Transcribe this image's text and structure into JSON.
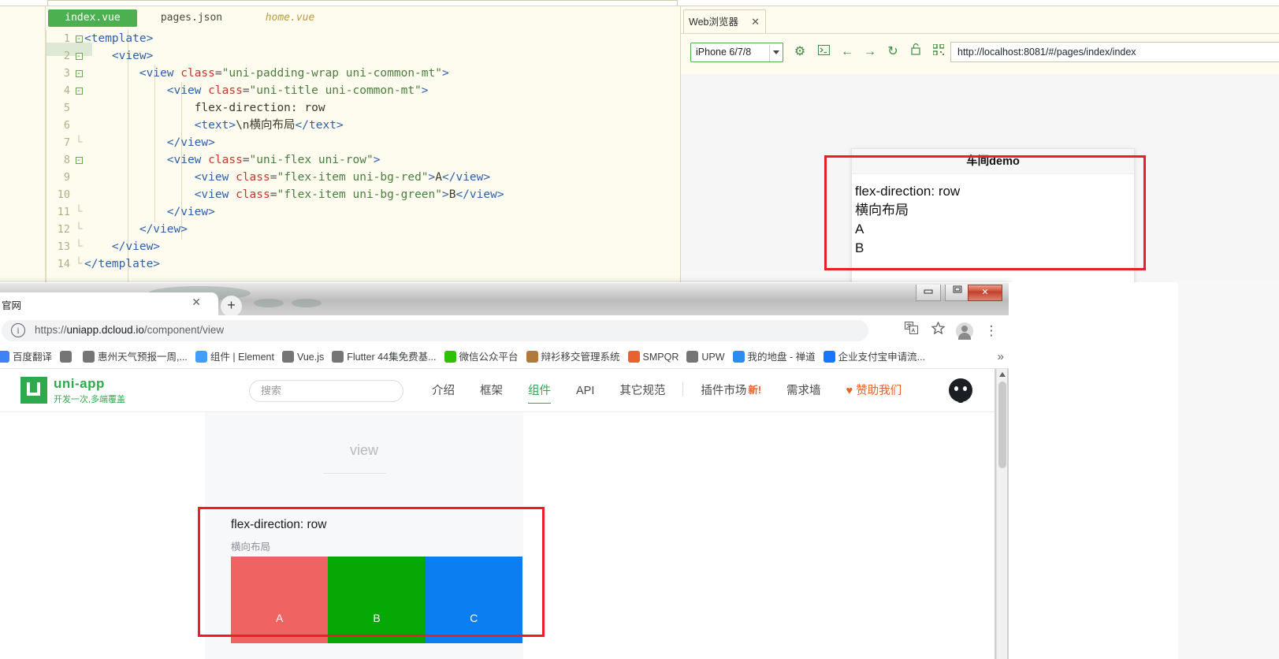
{
  "ide": {
    "tabs": [
      {
        "label": "index.vue",
        "state": "active"
      },
      {
        "label": "pages.json",
        "state": "inactive"
      },
      {
        "label": "home.vue",
        "state": "italic"
      }
    ],
    "code_lines": [
      {
        "num": "1",
        "fold": "minus",
        "html": "<span class=\"tk-tag\">&lt;template&gt;</span>"
      },
      {
        "num": "2",
        "fold": "minus",
        "html": "    <span class=\"tk-tag\">&lt;view&gt;</span>"
      },
      {
        "num": "3",
        "fold": "minus",
        "html": "        <span class=\"tk-tag\">&lt;view </span><span class=\"tk-attr\">class</span><span class=\"tk-eq\">=</span><span class=\"tk-str\">\"uni-padding-wrap uni-common-mt\"</span><span class=\"tk-tag\">&gt;</span>"
      },
      {
        "num": "4",
        "fold": "minus",
        "html": "            <span class=\"tk-tag\">&lt;view </span><span class=\"tk-attr\">class</span><span class=\"tk-eq\">=</span><span class=\"tk-str\">\"uni-title uni-common-mt\"</span><span class=\"tk-tag\">&gt;</span>"
      },
      {
        "num": "5",
        "fold": "none",
        "html": "                <span class=\"tk-txt\">flex-direction: row</span>"
      },
      {
        "num": "6",
        "fold": "none",
        "html": "                <span class=\"tk-tag\">&lt;text&gt;</span><span class=\"tk-txt\">\\n横向布局</span><span class=\"tk-tag\">&lt;/text&gt;</span>"
      },
      {
        "num": "7",
        "fold": "bar",
        "html": "            <span class=\"tk-tag\">&lt;/view&gt;</span>"
      },
      {
        "num": "8",
        "fold": "minus",
        "html": "            <span class=\"tk-tag\">&lt;view </span><span class=\"tk-attr\">class</span><span class=\"tk-eq\">=</span><span class=\"tk-str\">\"uni-flex uni-row\"</span><span class=\"tk-tag\">&gt;</span>"
      },
      {
        "num": "9",
        "fold": "none",
        "html": "                <span class=\"tk-tag\">&lt;view </span><span class=\"tk-attr\">class</span><span class=\"tk-eq\">=</span><span class=\"tk-str\">\"flex-item uni-bg-red\"</span><span class=\"tk-tag\">&gt;</span><span class=\"tk-txt\">A</span><span class=\"tk-tag\">&lt;/view&gt;</span>"
      },
      {
        "num": "10",
        "fold": "none",
        "html": "                <span class=\"tk-tag\">&lt;view </span><span class=\"tk-attr\">class</span><span class=\"tk-eq\">=</span><span class=\"tk-str\">\"flex-item uni-bg-green\"</span><span class=\"tk-tag\">&gt;</span><span class=\"tk-txt\">B</span><span class=\"tk-tag\">&lt;/view&gt;</span>"
      },
      {
        "num": "11",
        "fold": "bar",
        "html": "            <span class=\"tk-tag\">&lt;/view&gt;</span>"
      },
      {
        "num": "12",
        "fold": "bar",
        "html": "        <span class=\"tk-tag\">&lt;/view&gt;</span>"
      },
      {
        "num": "13",
        "fold": "bar",
        "html": "    <span class=\"tk-tag\">&lt;/view&gt;</span>"
      },
      {
        "num": "14",
        "fold": "bar",
        "html": "<span class=\"tk-tag\">&lt;/template&gt;</span>"
      }
    ],
    "preview": {
      "tab_label": "Web浏览器",
      "close_label": "✕",
      "device": "iPhone 6/7/8",
      "url": "http://localhost:8081/#/pages/index/index",
      "toolbar_icons": [
        "settings-icon",
        "console-icon",
        "back-icon",
        "forward-icon",
        "reload-icon",
        "unlock-icon",
        "qrcode-icon"
      ],
      "page_title": "车间demo",
      "lines": [
        "flex-direction: row",
        "横向布局",
        "A",
        "B"
      ]
    }
  },
  "chrome": {
    "tab_title": "官网",
    "tab_close": "✕",
    "new_tab": "+",
    "window_buttons": {
      "minimize": "―",
      "maximize": "❐",
      "close": "✕"
    },
    "url_prefix": "https://",
    "url_domain": "uniapp.dcloud.io",
    "url_path": "/component/view",
    "toolbar_icons": [
      "translate-icon",
      "bookmark-star-icon",
      "profile-avatar",
      "chrome-menu-icon"
    ],
    "bookmarks": [
      {
        "label": "百度翻译",
        "color": "#3b83f6"
      },
      {
        "label": "",
        "color": "#757575"
      },
      {
        "label": "惠州天气预报一周,...",
        "color": "#757575"
      },
      {
        "label": "组件 | Element",
        "color": "#409eff"
      },
      {
        "label": "Vue.js",
        "color": "#757575"
      },
      {
        "label": "Flutter 44集免费基...",
        "color": "#757575"
      },
      {
        "label": "微信公众平台",
        "color": "#2dc100"
      },
      {
        "label": "辩衫移交管理系统",
        "color": "#b07a3c"
      },
      {
        "label": "SMPQR",
        "color": "#e8622c"
      },
      {
        "label": "UPW",
        "color": "#757575"
      },
      {
        "label": "我的地盘 - 禅道",
        "color": "#2d8cf0"
      },
      {
        "label": "企业支付宝申请流...",
        "color": "#1677ff"
      }
    ],
    "bookmarks_overflow": "»"
  },
  "site": {
    "logo_name": "uni-app",
    "logo_tagline": "开发一次,多端覆盖",
    "search_placeholder": "搜索",
    "nav": [
      {
        "label": "介绍",
        "active": false
      },
      {
        "label": "框架",
        "active": false
      },
      {
        "label": "组件",
        "active": true
      },
      {
        "label": "API",
        "active": false
      },
      {
        "label": "其它规范",
        "active": false
      },
      {
        "label": "插件市场",
        "active": false,
        "badge": "新!"
      },
      {
        "label": "需求墙",
        "active": false
      },
      {
        "label": "赞助我们",
        "active": false,
        "heart": "♥"
      }
    ],
    "github_icon": "github-icon",
    "doc": {
      "heading": "view",
      "demo_title": "flex-direction: row",
      "demo_subtitle": "横向布局",
      "boxes": [
        {
          "label": "A",
          "color": "#ef6363"
        },
        {
          "label": "B",
          "color": "#06a806"
        },
        {
          "label": "C",
          "color": "#0b7ef2"
        }
      ]
    }
  },
  "annotations": {
    "highlight_color": "#ee1c25"
  }
}
